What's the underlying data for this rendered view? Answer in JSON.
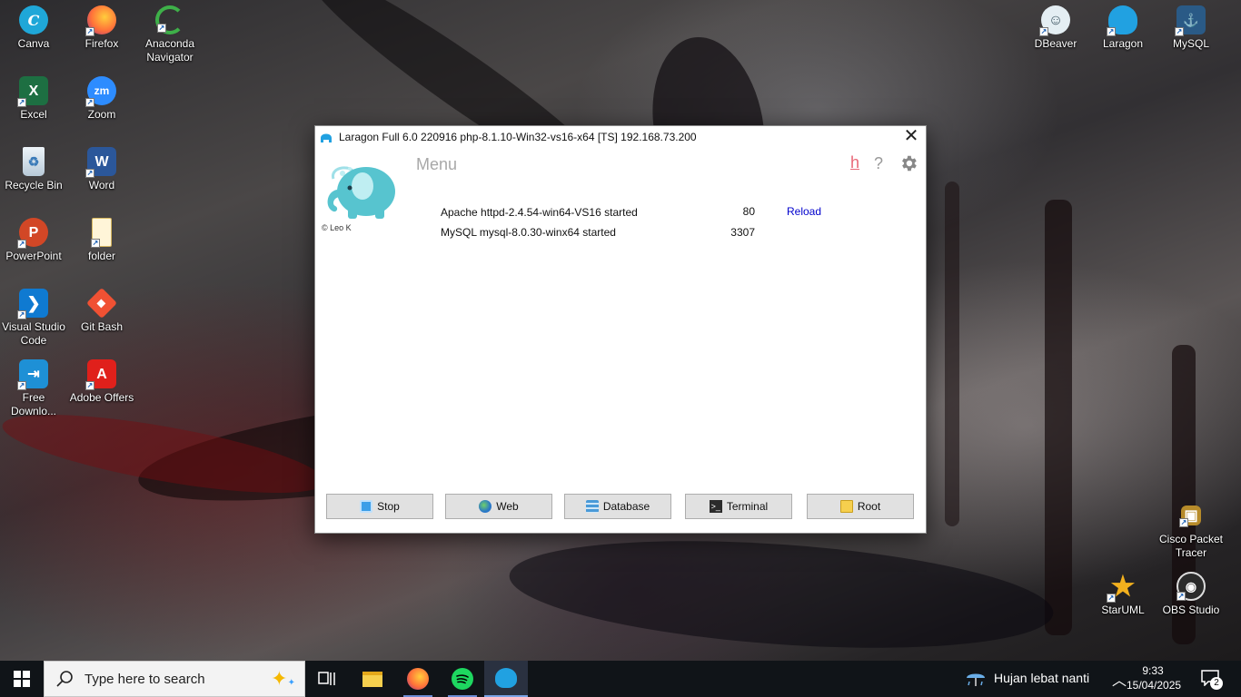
{
  "desktop": {
    "left_icons": [
      {
        "label": "Canva",
        "icon": "canva-icon",
        "color": "#1fa7d8"
      },
      {
        "label": "Firefox",
        "icon": "firefox-icon",
        "color": "#ff7139"
      },
      {
        "label": "Anaconda Navigator",
        "icon": "anaconda-icon",
        "color": "#3eb049"
      },
      {
        "label": "Excel",
        "icon": "excel-icon",
        "color": "#1d6f42"
      },
      {
        "label": "Zoom",
        "icon": "zoom-icon",
        "color": "#2d8cff"
      },
      {
        "label": "Recycle Bin",
        "icon": "recycle-bin-icon",
        "color": "#d7e4ee"
      },
      {
        "label": "Word",
        "icon": "word-icon",
        "color": "#2b579a"
      },
      {
        "label": "PowerPoint",
        "icon": "powerpoint-icon",
        "color": "#d24726"
      },
      {
        "label": "folder",
        "icon": "folder-icon",
        "color": "#f3d27a"
      },
      {
        "label": "Visual Studio Code",
        "icon": "vscode-icon",
        "color": "#0f7ad1"
      },
      {
        "label": "Git Bash",
        "icon": "git-bash-icon",
        "color": "#f05133"
      },
      {
        "label": "Free Downlo...",
        "icon": "free-download-icon",
        "color": "#1e90d6"
      },
      {
        "label": "Adobe Offers",
        "icon": "adobe-icon",
        "color": "#e0201b"
      }
    ],
    "right_icons": [
      {
        "label": "DBeaver",
        "icon": "dbeaver-icon",
        "color": "#5f7b8c"
      },
      {
        "label": "Laragon",
        "icon": "laragon-icon",
        "color": "#21a1e1"
      },
      {
        "label": "MySQL",
        "icon": "mysql-icon",
        "color": "#2a5a86"
      },
      {
        "label": "Cisco Packet Tracer",
        "icon": "cisco-packet-tracer-icon",
        "color": "#b78b2a"
      },
      {
        "label": "StarUML",
        "icon": "staruml-icon",
        "color": "#f2b01e"
      },
      {
        "label": "OBS Studio",
        "icon": "obs-icon",
        "color": "#2b2b2b"
      }
    ]
  },
  "laragon": {
    "title": "Laragon Full 6.0 220916 php-8.1.10-Win32-vs16-x64 [TS]  192.168.73.200",
    "copyright": "© Leo K",
    "menu_label": "Menu",
    "h_label": "h",
    "help_label": "?",
    "services": [
      {
        "name": "Apache httpd-2.4.54-win64-VS16 started",
        "port": "80",
        "action": "Reload"
      },
      {
        "name": "MySQL mysql-8.0.30-winx64 started",
        "port": "3307",
        "action": ""
      }
    ],
    "buttons": {
      "stop": "Stop",
      "web": "Web",
      "database": "Database",
      "terminal": "Terminal",
      "root": "Root"
    },
    "accent_link": "#0000cc"
  },
  "taskbar": {
    "search_placeholder": "Type here to search",
    "weather": "Hujan lebat nanti",
    "time": "9:33",
    "date": "15/04/2025",
    "notifications": "2"
  }
}
